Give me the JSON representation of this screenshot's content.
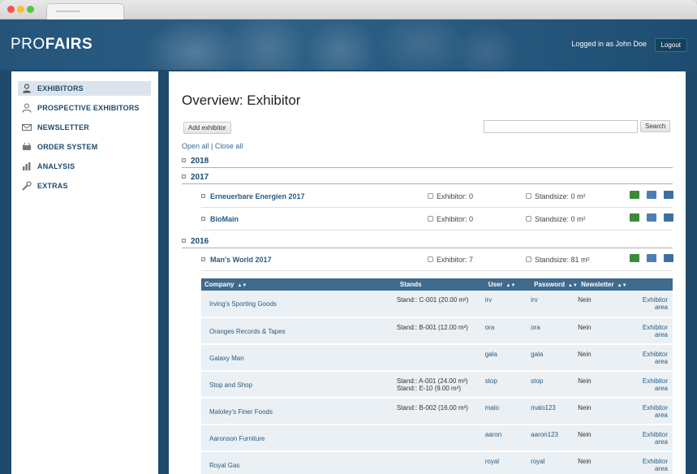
{
  "header": {
    "logo_part1": "PRO",
    "logo_part2": "FAIRS",
    "logged_in": "Logged in as John Doe",
    "logout": "Logout"
  },
  "sidebar": {
    "items": [
      {
        "label": "EXHIBITORS",
        "icon": "person-icon"
      },
      {
        "label": "PROSPECTIVE EXHIBITORS",
        "icon": "person-outline-icon"
      },
      {
        "label": "NEWSLETTER",
        "icon": "envelope-icon"
      },
      {
        "label": "ORDER SYSTEM",
        "icon": "cart-icon"
      },
      {
        "label": "ANALYSIS",
        "icon": "bar-chart-icon"
      },
      {
        "label": "EXTRAS",
        "icon": "wrench-icon"
      }
    ]
  },
  "main": {
    "title": "Overview: Exhibitor",
    "add_button": "Add exhibitor",
    "search_placeholder": "",
    "search_button": "Search",
    "open_all": "Open all",
    "separator": "|",
    "close_all": "Close all",
    "years": [
      "2018",
      "2017",
      "2016"
    ],
    "events": [
      {
        "name": "Erneuerbare Energien 2017",
        "exhibitor": "Exhibitor: 0",
        "standsize": "Standsize: 0 m²"
      },
      {
        "name": "BioMain",
        "exhibitor": "Exhibitor: 0",
        "standsize": "Standsize: 0 m²"
      },
      {
        "name": "Man's World 2017",
        "exhibitor": "Exhibitor: 7",
        "standsize": "Standsize: 81 m²"
      }
    ],
    "table": {
      "headers": {
        "company": "Company",
        "stands": "Stands",
        "user": "User",
        "password": "Password",
        "newsletter": "Newsletter"
      },
      "rows": [
        {
          "company": "Irving's Sporting Goods",
          "stands1": "Stand:: C-001 (20.00 m²)",
          "stands2": "",
          "user": "irv",
          "password": "irv",
          "newsletter": "Nein",
          "area1": "Exhibitor",
          "area2": "area"
        },
        {
          "company": "Oranges Records & Tapes",
          "stands1": "Stand:: B-001 (12.00 m²)",
          "stands2": "",
          "user": "ora",
          "password": "ora",
          "newsletter": "Nein",
          "area1": "Exhibitor",
          "area2": "area"
        },
        {
          "company": "Galaxy Man",
          "stands1": "",
          "stands2": "",
          "user": "gala",
          "password": "gala",
          "newsletter": "Nein",
          "area1": "Exhibitor",
          "area2": "area"
        },
        {
          "company": "Stop and Shop",
          "stands1": "Stand:: A-001 (24.00 m²)",
          "stands2": "Stand:: E-10 (9.00 m²)",
          "user": "stop",
          "password": "stop",
          "newsletter": "Nein",
          "area1": "Exhibitor",
          "area2": "area"
        },
        {
          "company": "Maloley's Finer Foods",
          "stands1": "Stand:: B-002 (16.00 m²)",
          "stands2": "",
          "user": "malo",
          "password": "malo123",
          "newsletter": "Nein",
          "area1": "Exhibitor",
          "area2": "area"
        },
        {
          "company": "Aaronson Furniture",
          "stands1": "",
          "stands2": "",
          "user": "aaron",
          "password": "aaron123",
          "newsletter": "Nein",
          "area1": "Exhibitor",
          "area2": "area"
        },
        {
          "company": "Royal Gas",
          "stands1": "",
          "stands2": "",
          "user": "royal",
          "password": "royal",
          "newsletter": "Nein",
          "area1": "Exhibitor",
          "area2": "area"
        }
      ]
    }
  }
}
